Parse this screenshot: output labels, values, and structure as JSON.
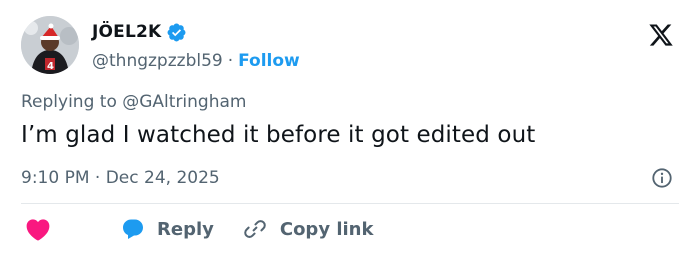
{
  "author": {
    "display_name": "JÖEL2K",
    "handle": "@thngzpzzbl59",
    "separator": "·",
    "follow_label": "Follow"
  },
  "reply": {
    "prefix": "Replying to",
    "mention": "@GAltringham"
  },
  "tweet": {
    "text": "I’m glad I watched it before it got edited out",
    "time": "9:10 PM",
    "separator": "·",
    "date": "Dec 24, 2025"
  },
  "actions": {
    "reply_label": "Reply",
    "copy_link_label": "Copy link"
  },
  "icons": {
    "verified": "verified-badge-icon",
    "brand": "x-logo-icon",
    "info": "info-icon",
    "like": "heart-icon",
    "reply": "reply-bubble-icon",
    "link": "link-icon"
  },
  "colors": {
    "accent": "#1d9bf0",
    "like": "#f91880",
    "muted": "#536471",
    "text": "#0f1419",
    "divider": "#e4e8eb"
  }
}
